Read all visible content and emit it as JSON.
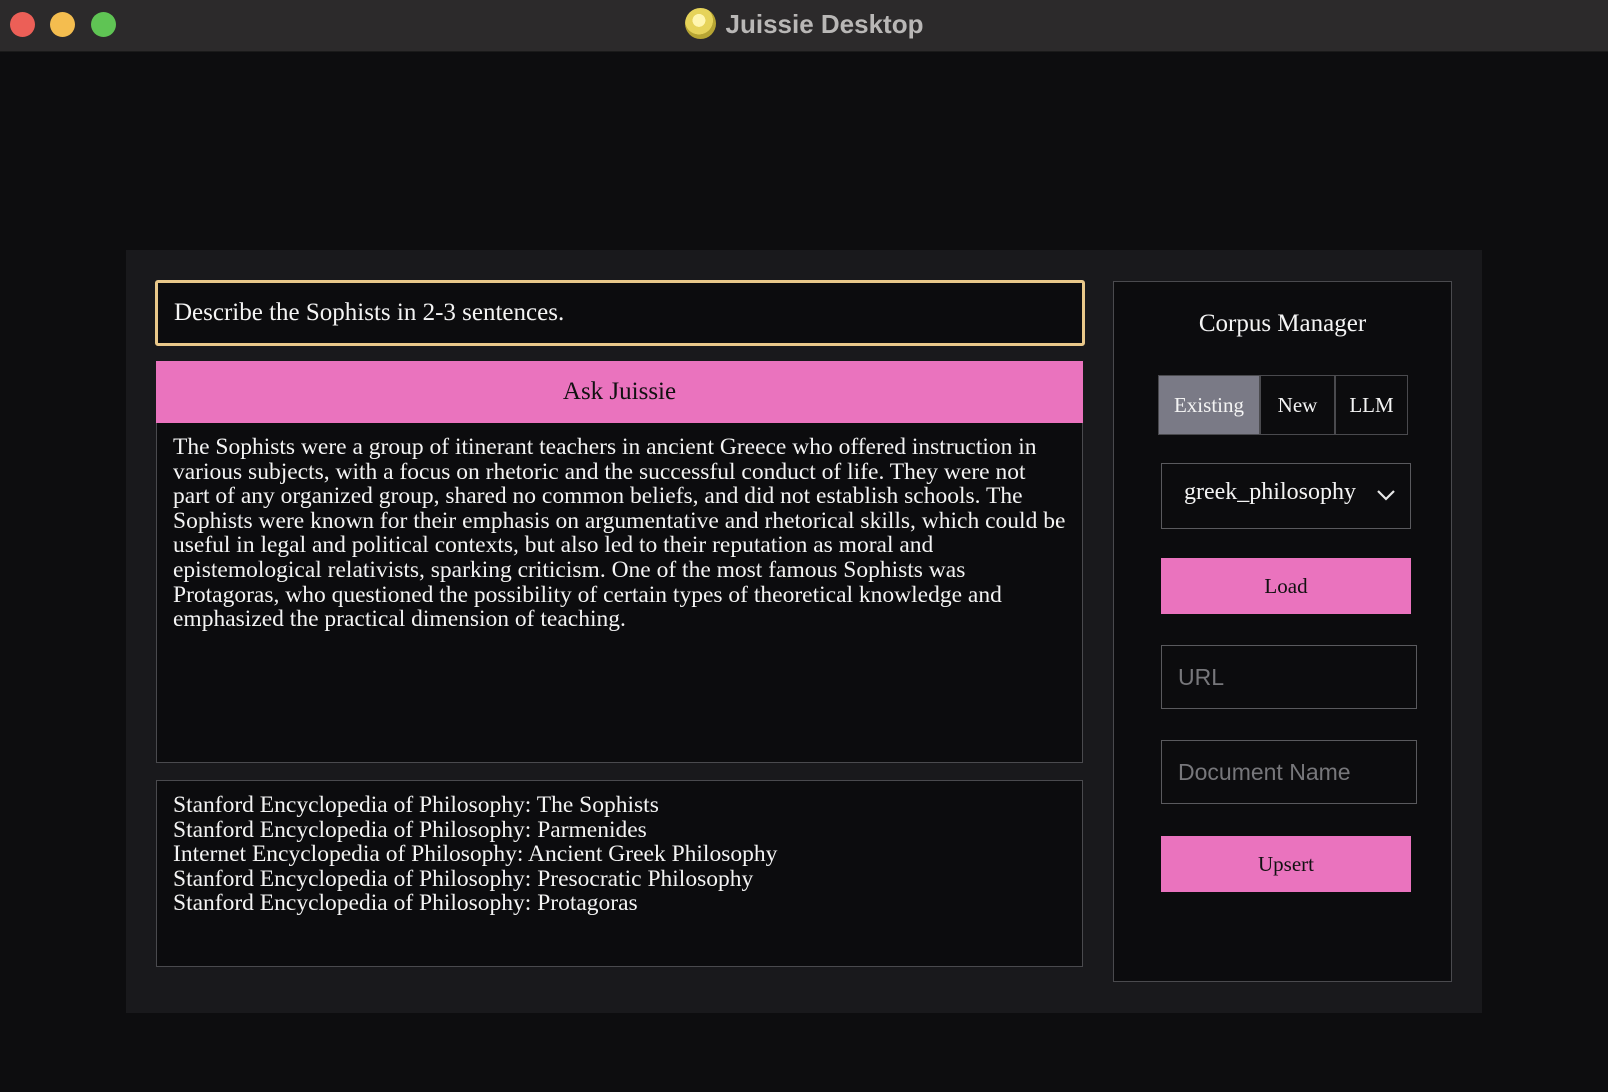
{
  "window": {
    "title": "Juissie Desktop",
    "app_icon": "juissie-logo-icon"
  },
  "query": {
    "value": "Describe the Sophists in 2-3 sentences."
  },
  "ask_button": {
    "label": "Ask Juissie",
    "color": "#ea73be"
  },
  "answer": {
    "text": "The Sophists were a group of itinerant teachers in ancient Greece who offered instruction in various subjects, with a focus on rhetoric and the successful conduct of life. They were not part of any organized group, shared no common beliefs, and did not establish schools. The Sophists were known for their emphasis on argumentative and rhetorical skills, which could be useful in legal and political contexts, but also led to their reputation as moral and epistemological relativists, sparking criticism. One of the most famous Sophists was Protagoras, who questioned the possibility of certain types of theoretical knowledge and emphasized the practical dimension of teaching."
  },
  "sources": [
    "Stanford Encyclopedia of Philosophy: The Sophists",
    "Stanford Encyclopedia of Philosophy: Parmenides",
    "Internet Encyclopedia of Philosophy: Ancient Greek Philosophy",
    "Stanford Encyclopedia of Philosophy: Presocratic Philosophy",
    "Stanford Encyclopedia of Philosophy: Protagoras"
  ],
  "corpus_manager": {
    "title": "Corpus Manager",
    "tabs": [
      {
        "label": "Existing",
        "selected": true
      },
      {
        "label": "New",
        "selected": false
      },
      {
        "label": "LLM",
        "selected": false
      }
    ],
    "corpus_select": {
      "value": "greek_philosophy",
      "icon": "chevron-down-icon"
    },
    "load_label": "Load",
    "url_field": {
      "value": "",
      "placeholder": "URL"
    },
    "document_name_field": {
      "value": "",
      "placeholder": "Document Name"
    },
    "upsert_label": "Upsert"
  }
}
